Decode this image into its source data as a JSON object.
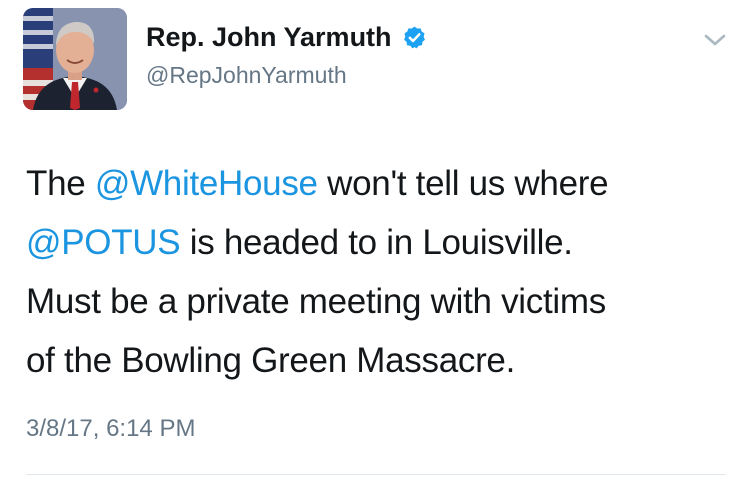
{
  "tweet": {
    "author": {
      "display_name": "Rep. John Yarmuth",
      "handle": "@RepJohnYarmuth",
      "verified": true,
      "avatar_icon": "avatar-photo"
    },
    "text_lines": [
      [
        {
          "text": "The ",
          "mention": false
        },
        {
          "text": "@WhiteHouse",
          "mention": true
        },
        {
          "text": " won't tell us where",
          "mention": false
        }
      ],
      [
        {
          "text": "@POTUS",
          "mention": true
        },
        {
          "text": " is headed to in Louisville.",
          "mention": false
        }
      ],
      [
        {
          "text": "Must be a private meeting with victims",
          "mention": false
        }
      ],
      [
        {
          "text": "of the Bowling Green Massacre.",
          "mention": false
        }
      ]
    ],
    "timestamp": "3/8/17, 6:14 PM",
    "menu_icon": "chevron-down-icon",
    "colors": {
      "mention": "#1b95e0",
      "verified": "#1da1f2",
      "secondary_text": "#657786",
      "primary_text": "#14171a"
    }
  }
}
